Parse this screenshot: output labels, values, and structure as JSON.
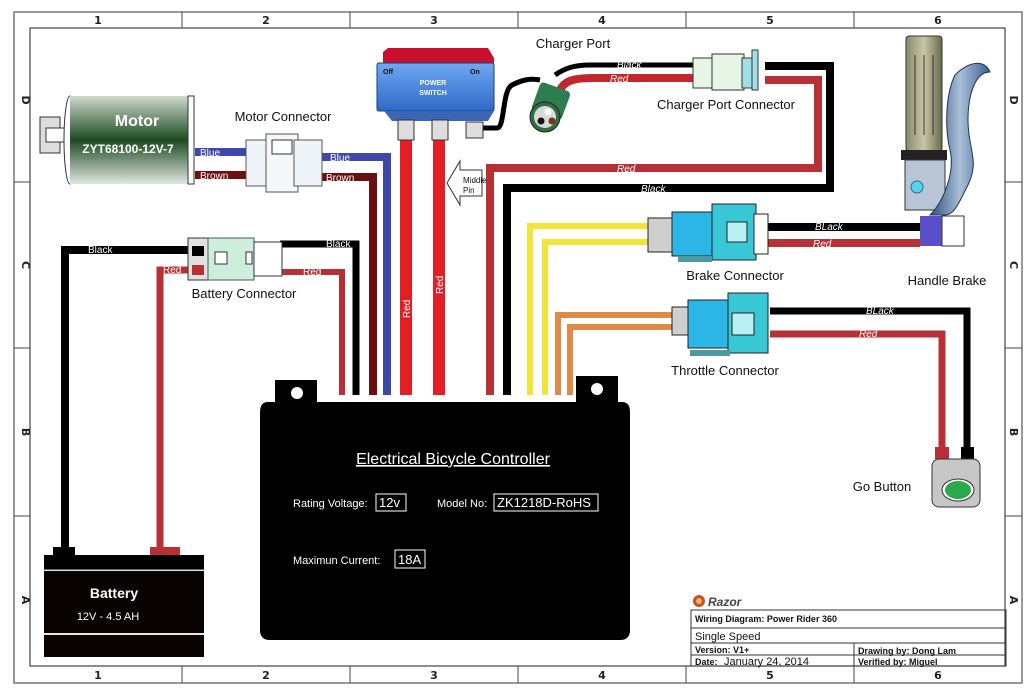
{
  "frame": {
    "columns": [
      "1",
      "2",
      "3",
      "4",
      "5",
      "6"
    ],
    "rows": [
      "D",
      "C",
      "B",
      "A"
    ]
  },
  "components": {
    "motor": {
      "title": "Motor",
      "model": "ZYT68100-12V-7"
    },
    "motor_connector": {
      "label": "Motor Connector"
    },
    "power_switch": {
      "title_line1": "POWER",
      "title_line2": "SWITCH",
      "off": "Off",
      "on": "On",
      "middle_pin_line1": "Middle",
      "middle_pin_line2": "Pin"
    },
    "charger_port": {
      "label": "Charger Port"
    },
    "charger_port_connector": {
      "label": "Charger Port Connector"
    },
    "battery_connector": {
      "label": "Battery Connector"
    },
    "brake_connector": {
      "label": "Brake Connector"
    },
    "handle_brake": {
      "label": "Handle Brake"
    },
    "throttle_connector": {
      "label": "Throttle Connector"
    },
    "go_button": {
      "label": "Go Button"
    },
    "battery": {
      "title": "Battery",
      "spec": "12V - 4.5 AH"
    },
    "controller": {
      "title": "Electrical Bicycle Controller",
      "rating_voltage_label": "Rating Voltage:",
      "rating_voltage": "12v",
      "model_label": "Model No:",
      "model": "ZK1218D-RoHS",
      "max_current_label": "Maximun Current:",
      "max_current": "18A"
    }
  },
  "wires": {
    "blue": "Blue",
    "brown": "Brown",
    "black": "Black",
    "red": "Red",
    "black_alt": "BLack"
  },
  "colors": {
    "black": "#000000",
    "red": "#c1272d",
    "bright_red": "#e31e24",
    "blue": "#3f48a8",
    "brown": "#6b0f10",
    "yellow": "#f2e53a",
    "orange": "#e08a4a"
  },
  "title_block": {
    "brand": "Razor",
    "diagram": "Wiring Diagram: Power Rider 360",
    "variant": "Single Speed",
    "version": "Version: V1+",
    "date_label": "Date:",
    "date": "January 24, 2014",
    "drawing_by": "Drawing by: Dong Lam",
    "verified_by": "Verified by: Miguel"
  }
}
